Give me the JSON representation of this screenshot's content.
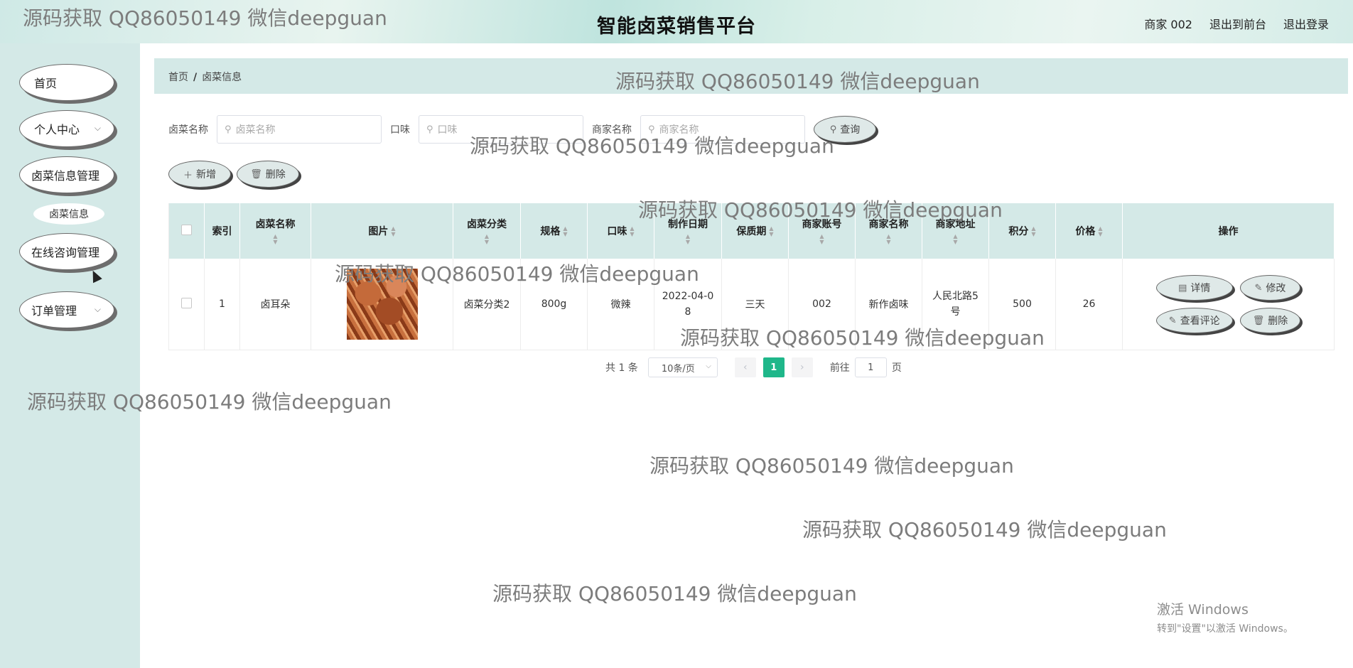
{
  "header": {
    "title": "智能卤菜销售平台",
    "user": "商家 002",
    "back_to_front": "退出到前台",
    "logout": "退出登录"
  },
  "sidebar": {
    "items": [
      {
        "label": "首页"
      },
      {
        "label": "个人中心"
      },
      {
        "label": "卤菜信息管理"
      },
      {
        "label": "卤菜信息"
      },
      {
        "label": "在线咨询管理"
      },
      {
        "label": "订单管理"
      }
    ]
  },
  "breadcrumb": {
    "home": "首页",
    "separator": "/",
    "current": "卤菜信息"
  },
  "search": {
    "name_label": "卤菜名称",
    "name_placeholder": "卤菜名称",
    "taste_label": "口味",
    "taste_placeholder": "口味",
    "merchant_label": "商家名称",
    "merchant_placeholder": "商家名称",
    "query_button": "查询"
  },
  "actions": {
    "add": "新增",
    "delete": "删除"
  },
  "table": {
    "columns": [
      "索引",
      "卤菜名称",
      "图片",
      "卤菜分类",
      "规格",
      "口味",
      "制作日期",
      "保质期",
      "商家账号",
      "商家名称",
      "商家地址",
      "积分",
      "价格",
      "操作"
    ],
    "rows": [
      {
        "index": "1",
        "name": "卤耳朵",
        "category": "卤菜分类2",
        "spec": "800g",
        "taste": "微辣",
        "date": "2022-04-0\n8",
        "shelf_life": "三天",
        "account": "002",
        "merchant": "新作卤味",
        "address": "人民北路5\n号",
        "points": "500",
        "price": "26"
      }
    ],
    "ops": {
      "detail": "详情",
      "edit": "修改",
      "review": "查看评论",
      "delete": "删除"
    }
  },
  "pagination": {
    "total": "共 1 条",
    "page_size": "10条/页",
    "current": "1",
    "goto_label": "前往",
    "goto_value": "1",
    "page_unit": "页"
  },
  "watermark": {
    "text": "源码获取 QQ86050149 微信deepguan"
  },
  "os_overlay": {
    "line1": "激活 Windows",
    "line2": "转到\"设置\"以激活 Windows。"
  }
}
